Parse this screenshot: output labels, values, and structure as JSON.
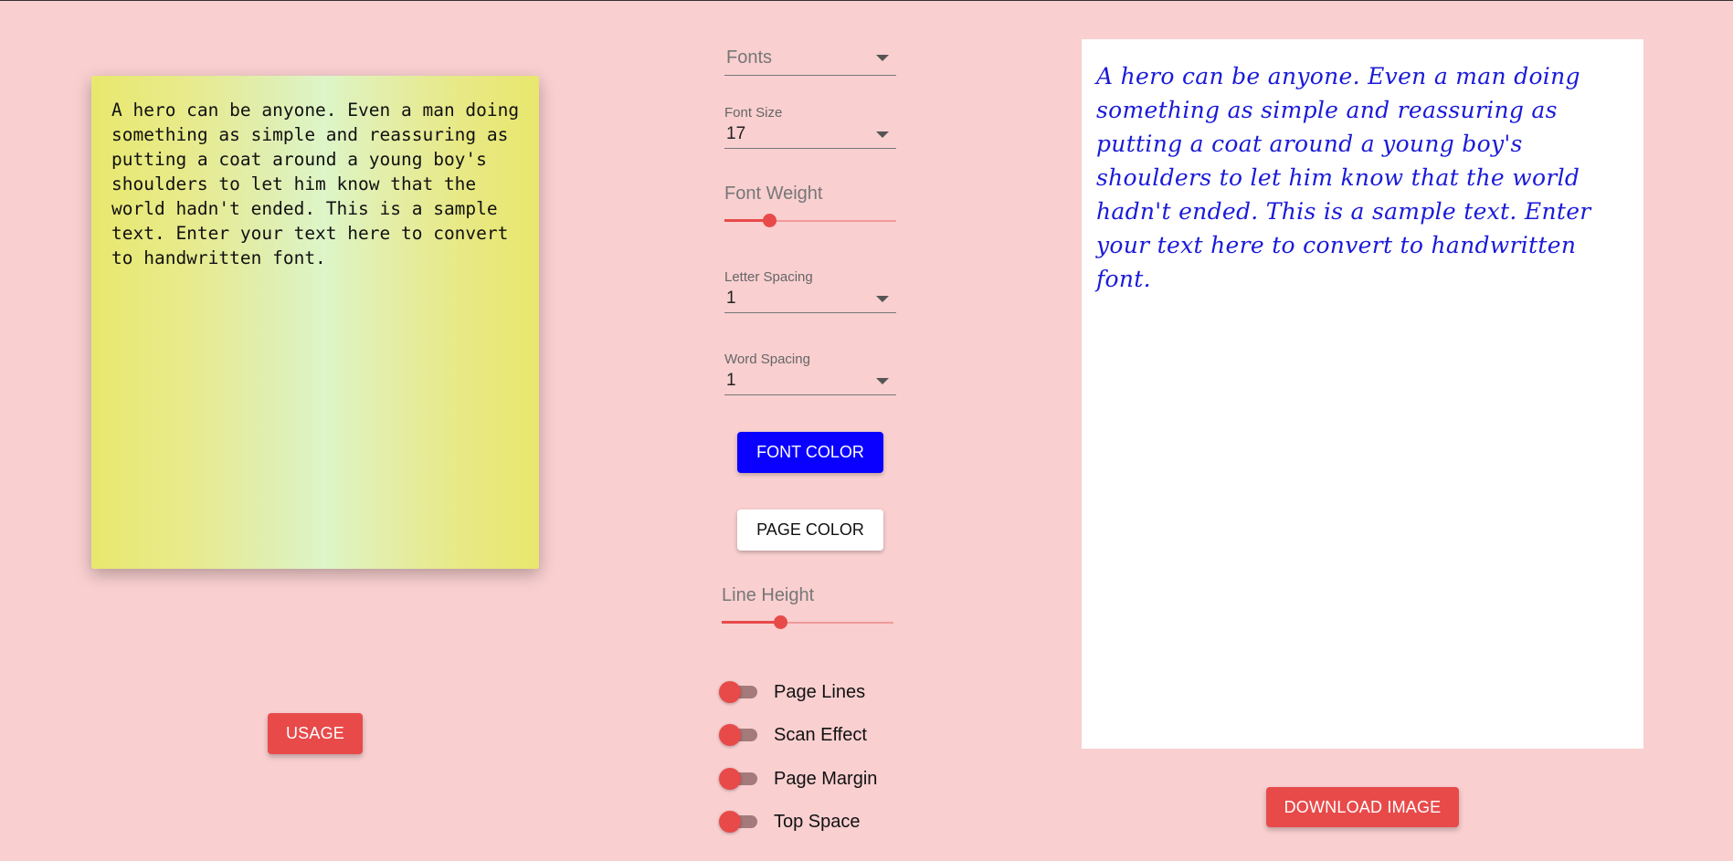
{
  "input": {
    "text": "A hero can be anyone. Even a man doing something as simple and reassuring as putting a coat around a young boy's shoulders to let him know that the world hadn't ended. This is a sample text. Enter your text here to convert to handwritten font."
  },
  "usage_button": {
    "label": "USAGE"
  },
  "controls": {
    "fonts": {
      "placeholder": "Fonts"
    },
    "font_size": {
      "label": "Font Size",
      "value": "17"
    },
    "font_weight": {
      "label": "Font Weight",
      "level": 0.26
    },
    "letter_spacing": {
      "label": "Letter Spacing",
      "value": "1"
    },
    "word_spacing": {
      "label": "Word Spacing",
      "value": "1"
    },
    "font_color_button": "FONT COLOR",
    "page_color_button": "PAGE COLOR",
    "line_height": {
      "label": "Line Height",
      "level": 0.34
    },
    "toggles": [
      {
        "label": "Page Lines",
        "on": false
      },
      {
        "label": "Scan Effect",
        "on": false
      },
      {
        "label": "Page Margin",
        "on": false
      },
      {
        "label": "Top Space",
        "on": false
      }
    ]
  },
  "output": {
    "text": "A hero can be anyone. Even a man doing something as simple and reassuring as putting a coat around a young boy's shoulders to let him know that the world hadn't ended. This is a sample text. Enter your text here to convert to handwritten font."
  },
  "download_button": {
    "label": "DOWNLOAD IMAGE"
  },
  "colors": {
    "background": "#f9cfd0",
    "accent": "#e84a4a",
    "font_color": "#0a00ff",
    "handwriting_color": "#1a1ad8"
  }
}
